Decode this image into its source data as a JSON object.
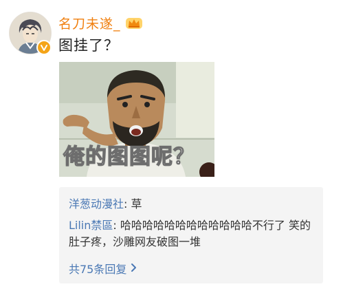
{
  "post": {
    "username": "名刀未遂_",
    "text": "图挂了？",
    "image_caption": "俺的图图呢？"
  },
  "replies": [
    {
      "author": "洋葱动漫社",
      "separator": ": ",
      "content": "草"
    },
    {
      "author": "Lilin禁區",
      "separator": ": ",
      "content": "哈哈哈哈哈哈哈哈哈哈哈哈不行了 笑的肚子疼，沙雕网友破图一堆"
    }
  ],
  "more_replies_label": "共75条回复",
  "icons": {
    "verified": "verified-badge-icon",
    "crown": "vip-crown-icon",
    "chevron": "chevron-right-icon"
  },
  "colors": {
    "username": "#f08010",
    "link_blue": "#4a78b4",
    "reply_bg": "#f4f4f4",
    "badge": "#f4a418"
  }
}
